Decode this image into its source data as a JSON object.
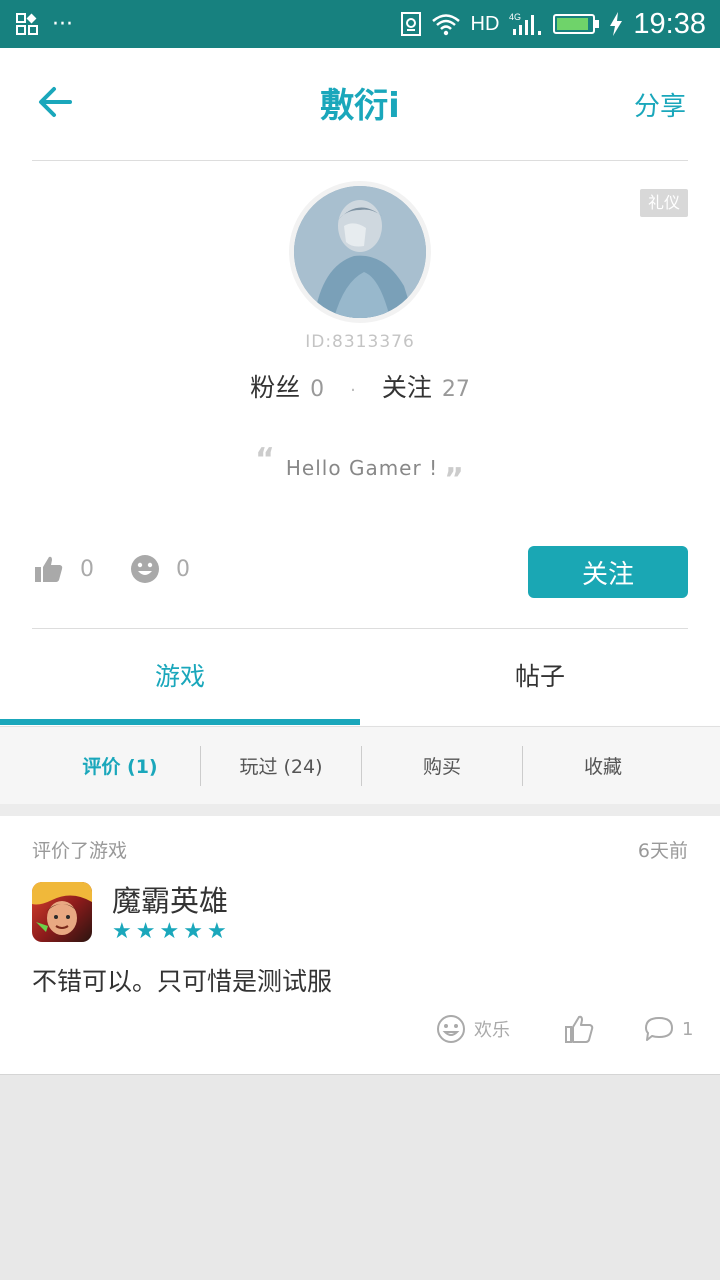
{
  "status_bar": {
    "network": "HD",
    "signal": "4G",
    "time": "19:38",
    "battery_level": 0.9
  },
  "header": {
    "title": "敷衍i",
    "share_label": "分享"
  },
  "profile": {
    "badge": "礼仪",
    "user_id": "ID:8313376",
    "fans_label": "粉丝",
    "fans_count": "0",
    "following_label": "关注",
    "following_count": "27",
    "signature": "Hello Gamer !",
    "likes_count": "0",
    "happy_count": "0",
    "follow_button": "关注"
  },
  "tabs": [
    {
      "label": "游戏",
      "active": true
    },
    {
      "label": "帖子",
      "active": false
    }
  ],
  "subtabs": [
    {
      "label": "评价 (1)",
      "active": true
    },
    {
      "label": "玩过 (24)",
      "active": false
    },
    {
      "label": "购买",
      "active": false
    },
    {
      "label": "收藏",
      "active": false
    }
  ],
  "review": {
    "action": "评价了游戏",
    "time": "6天前",
    "game_name": "魔霸英雄",
    "rating": 5,
    "text": "不错可以。只可惜是测试服",
    "fun_label": "欢乐",
    "comment_count": "1"
  },
  "colors": {
    "accent": "#1aa7bb",
    "status_bar": "#17817f"
  }
}
